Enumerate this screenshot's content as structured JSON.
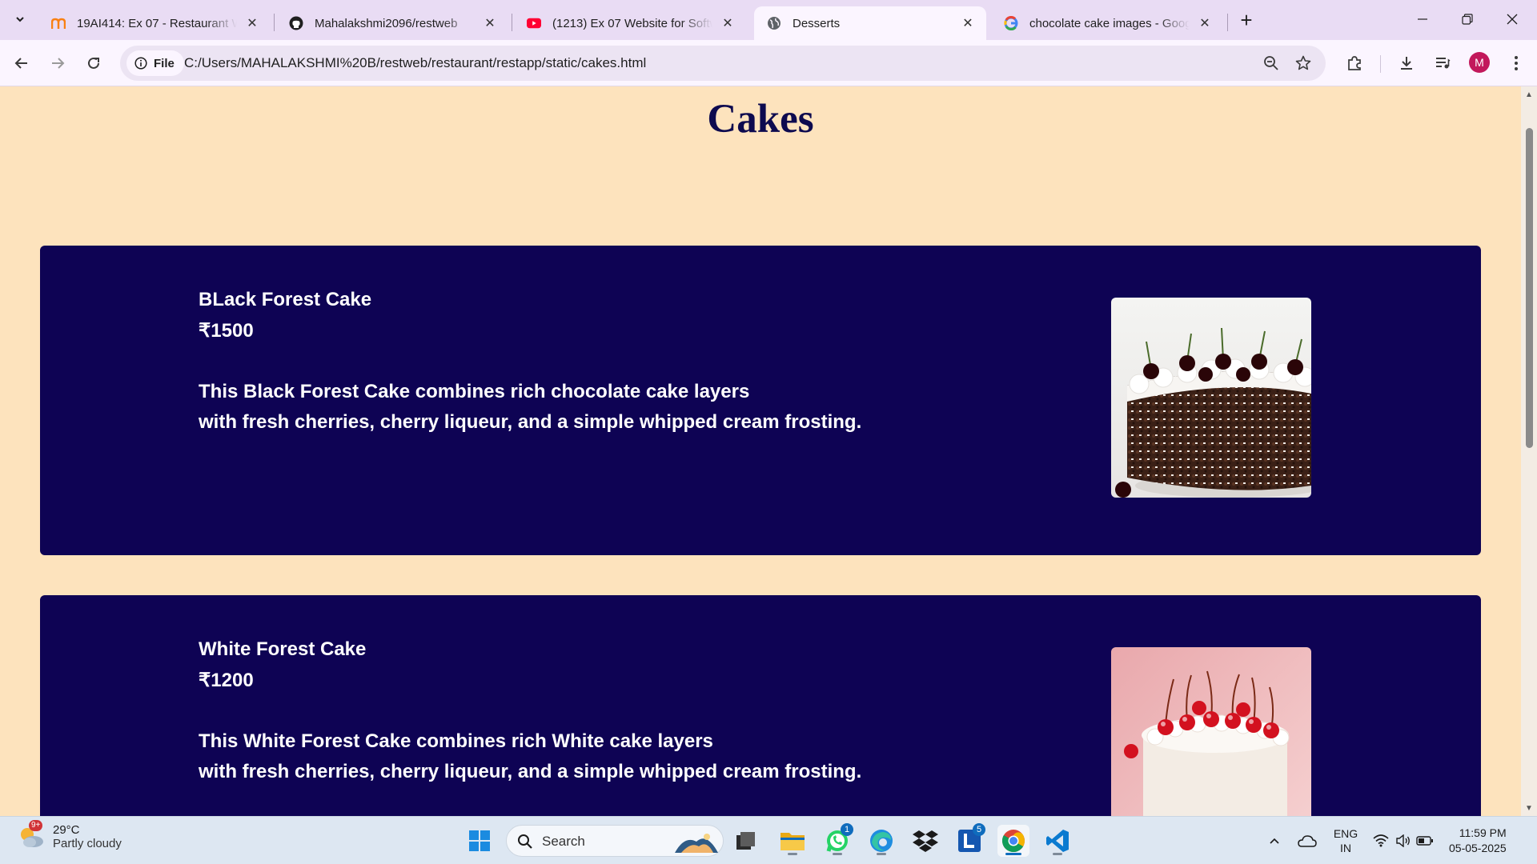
{
  "browser": {
    "tabs": [
      {
        "title": "19AI414: Ex 07 - Restaurant We",
        "icon": "moodle-icon"
      },
      {
        "title": "Mahalakshmi2096/restweb",
        "icon": "github-icon"
      },
      {
        "title": "(1213) Ex 07 Website for Softwa",
        "icon": "youtube-icon"
      },
      {
        "title": "Desserts",
        "icon": "globe-icon",
        "active": true
      },
      {
        "title": "chocolate cake images - Googl",
        "icon": "google-icon"
      }
    ],
    "site_chip": "File",
    "url": "C:/Users/MAHALAKSHMI%20B/restweb/restaurant/restapp/static/cakes.html",
    "profile_initial": "M"
  },
  "page": {
    "title": "Cakes",
    "cakes": [
      {
        "name": "BLack Forest Cake",
        "price": "₹1500",
        "desc_line1": "This Black Forest Cake combines rich chocolate cake layers",
        "desc_line2": "with fresh cherries, cherry liqueur, and a simple whipped cream frosting."
      },
      {
        "name": "White Forest Cake",
        "price": "₹1200",
        "desc_line1": "This White Forest Cake combines rich White cake layers",
        "desc_line2": "with fresh cherries, cherry liqueur, and a simple whipped cream frosting."
      }
    ]
  },
  "taskbar": {
    "weather_temp": "29°C",
    "weather_cond": "Partly cloudy",
    "weather_badge": "9+",
    "search_label": "Search",
    "whatsapp_badge": "1",
    "l_app_badge": "5",
    "lang_line1": "ENG",
    "lang_line2": "IN",
    "time": "11:59 PM",
    "date": "05-05-2025"
  },
  "colors": {
    "page_bg": "#fde3bd",
    "card_bg": "#0e0354",
    "title_color": "#0d0a4f"
  }
}
